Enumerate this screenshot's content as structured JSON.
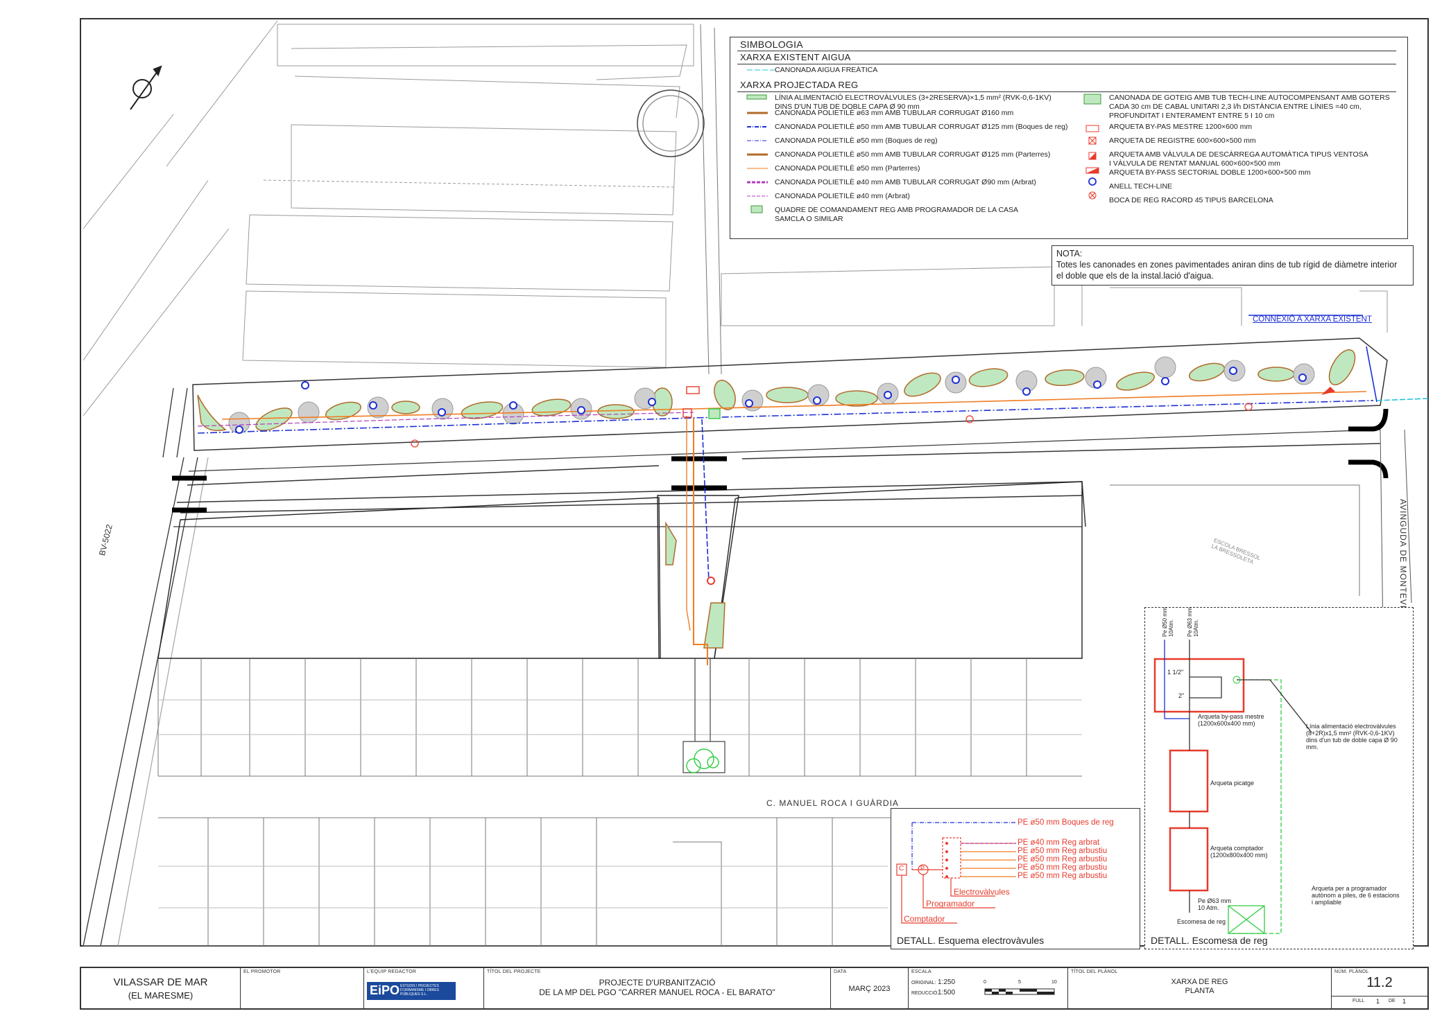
{
  "legend": {
    "title": "SIMBOLOGIA",
    "section_existing": "XARXA EXISTENT AIGUA",
    "existing_items": [
      "CANONADA AIGUA FREÀTICA"
    ],
    "section_projected": "XARXA PROJECTADA REG",
    "left_items": [
      "LÍNIA ALIMENTACIÓ ELECTROVÀLVULES (3+2RESERVA)×1,5 mm² (RVK-0,6-1KV)\nDINS D'UN TUB DE DOBLE CAPA Ø 90 mm",
      "CANONADA POLIETILÈ ø63 mm AMB TUBULAR CORRUGAT Ø160 mm",
      "CANONADA POLIETILÈ ø50 mm AMB TUBULAR CORRUGAT Ø125 mm (Boques de reg)",
      "CANONADA POLIETILÈ ø50 mm (Boques de reg)",
      "CANONADA POLIETILÈ ø50 mm AMB TUBULAR CORRUGAT Ø125 mm (Parterres)",
      "CANONADA POLIETILÈ ø50 mm (Parterres)",
      "CANONADA POLIETILÈ ø40 mm AMB TUBULAR CORRUGAT Ø90 mm (Arbrat)",
      "CANONADA POLIETILÈ ø40 mm (Arbrat)",
      "QUADRE  DE COMANDAMENT REG AMB PROGRAMADOR DE LA CASA\nSAMCLA O SIMILAR"
    ],
    "right_items": [
      "CANONADA DE GOTEIG AMB TUB TECH-LINE AUTOCOMPENSANT AMB GOTERS\nCADA 30 cm DE CABAL UNITARI 2,3 l/h DISTÀNCIA ENTRE LÍNIES =40 cm,\nPROFUNDITAT I ENTERAMENT ENTRE 5 I 10 cm",
      "ARQUETA BY-PAS MESTRE 1200×600 mm",
      "ARQUETA DE REGISTRE 600×600×500 mm",
      "ARQUETA AMB VÀLVULA DE DESCÀRREGA  AUTOMÀTICA TIPUS VENTOSA\nI VÀLVULA DE RENTAT MANUAL 600×600×500 mm",
      "ARQUETA BY-PASS SECTORIAL DOBLE 1200×600×500 mm",
      "ANELL TECH-LINE",
      "BOCA DE REG RACORD 45 TIPUS BARCELONA"
    ],
    "colors": {
      "green": "#3a9a3a",
      "orange": "#f07c22",
      "blue": "#1c2fd6",
      "red": "#e83a2c",
      "purple": "#b23bbd",
      "cyan": "#1fc4d8"
    }
  },
  "nota": {
    "title": "NOTA:",
    "text": "Totes les canonades en zones pavimentades aniran dins de tub rígid de diàmetre interior\nel doble que els de la instal.lació d'aigua."
  },
  "map": {
    "connexio": "CONNEXIÓ A XARXA EXISTENT",
    "road_left": "BV-5022",
    "street_bottom": "C. MANUEL ROCA I GUÀRDIA",
    "avenue_right": "AVINGUDA DE MONTEVIDEO",
    "school": "ESCOLA BRESSOL\nLA BRESSOLETA"
  },
  "detail_electro": {
    "title": "DETALL. Esquema electrovàvules",
    "lines": [
      "PE ø50 mm Boques de reg",
      "PE ø40 mm Reg arbrat",
      "PE ø50 mm Reg arbustiu",
      "PE ø50 mm Reg arbustiu",
      "PE ø50 mm Reg arbustiu",
      "PE ø50 mm Reg arbustiu"
    ],
    "electrovalvules": "Electrovàlvules",
    "programador": "Programador",
    "comptador": "Comptador",
    "c_label": "C",
    "p_label": "P"
  },
  "detail_escomesa": {
    "title": "DETALL. Escomesa de reg",
    "pe50": "Pe Ø50 mm\n10Atm.",
    "pe63": "Pe Ø63 mm\n10Atm.",
    "size_1_5": "1 1/2\"",
    "size_2": "2\"",
    "bypass": "Arqueta by-pass mestre\n(1200x600x400 mm)",
    "linia": "Línia alimentació electrovàlvules\n(8+2R)x1,5 mm² (RVK-0,6-1KV)\ndins d'un tub de doble capa Ø 90\nmm.",
    "picatge": "Arqueta picatge",
    "comptador": "Arqueta comptador\n(1200x800x400 mm)",
    "programador": "Arqueta per a programador\nautònom a piles, de 6 estacions\ni ampliable",
    "pe63_bottom": "Pe Ø63 mm\n10 Atm.",
    "escomesa": "Escomesa de reg"
  },
  "title_block": {
    "municipality": "VILASSAR DE MAR",
    "region": "(EL MARESME)",
    "lbl_promotor": "EL PROMOTOR",
    "lbl_equip": "L'EQUIP REDACTOR",
    "logo": "EiPO",
    "logo_sub": "ESTUDIS I PROJECTES\nD'URBANISME I OBRES\nPÚBLIQUES S.L.",
    "lbl_titol_projecte": "TÍTOL DEL PROJECTE",
    "project_line1": "PROJECTE D'URBANITZACIÓ",
    "project_line2": "DE LA MP DEL PGO \"CARRER MANUEL ROCA - EL BARATO\"",
    "lbl_data": "DATA",
    "date": "MARÇ 2023",
    "lbl_escala": "ESCALA",
    "lbl_original": "ORIGINAL:",
    "scale_original": "1:250",
    "lbl_reduccio": "REDUCCIÓ:",
    "scale_reduccio": "1:500",
    "scale_ticks": [
      "0",
      "5",
      "10"
    ],
    "lbl_titol_planol": "TÍTOL DEL PLÀNOL",
    "plan_line1": "XARXA DE REG",
    "plan_line2": "PLANTA",
    "lbl_num": "NÚM. PLÀNOL",
    "plan_number": "11.2",
    "lbl_full": "FULL",
    "full_a": "1",
    "lbl_de": "DE",
    "full_b": "1"
  }
}
